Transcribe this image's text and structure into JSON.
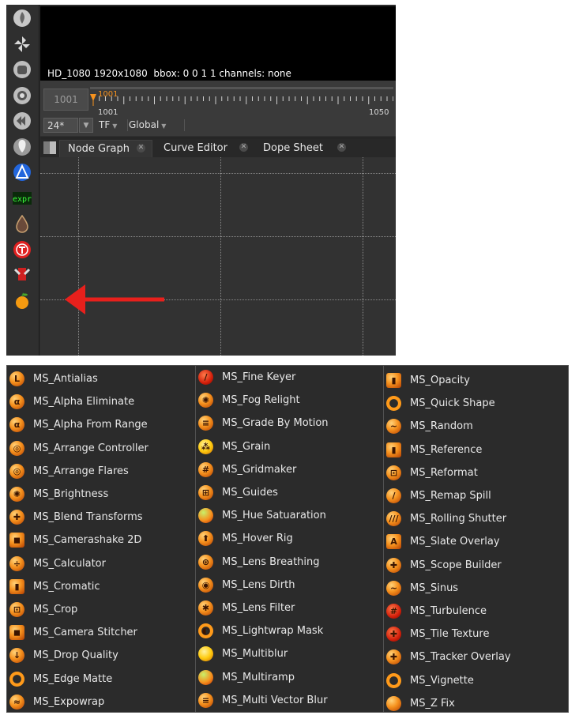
{
  "viewer": {
    "info": "HD_1080 1920x1080  bbox: 0 0 1 1 channels: none"
  },
  "timeline": {
    "current_frame": "1001",
    "marker_label": "1001",
    "start_label": "1001",
    "end_label": "1050"
  },
  "controls": {
    "fps": "24*",
    "tf": "TF",
    "global": "Global"
  },
  "tabs": [
    {
      "label": "Node Graph",
      "active": true
    },
    {
      "label": "Curve Editor",
      "active": false
    },
    {
      "label": "Dope Sheet",
      "active": false
    }
  ],
  "colors": {
    "arrow": "#e8201c",
    "accent": "#f6921e",
    "panel_bg": "#2b2b2b"
  },
  "toolbar_icons": [
    "flame-icon",
    "pinwheel-icon",
    "mask-icon",
    "target-icon",
    "rewind-icon",
    "lightbulb-icon",
    "atom-icon",
    "expr-icon",
    "drop-icon",
    "t-icon",
    "pen-icon",
    "fruit-icon"
  ],
  "menu": {
    "columns": [
      [
        "MS_Antialias",
        "MS_Alpha Eliminate",
        "MS_Alpha From Range",
        "MS_Arrange Controller",
        "MS_Arrange Flares",
        "MS_Brightness",
        "MS_Blend Transforms",
        "MS_Camerashake 2D",
        "MS_Calculator",
        "MS_Cromatic",
        "MS_Crop",
        "MS_Camera Stitcher",
        "MS_Drop Quality",
        "MS_Edge Matte",
        "MS_Expowrap"
      ],
      [
        "MS_Fine Keyer",
        "MS_Fog Relight",
        "MS_Grade By Motion",
        "MS_Grain",
        "MS_Gridmaker",
        "MS_Guides",
        "MS_Hue Satuaration",
        "MS_Hover Rig",
        "MS_Lens Breathing",
        "MS_Lens Dirth",
        "MS_Lens Filter",
        "MS_Lightwrap Mask",
        "MS_Multiblur",
        "MS_Multiramp",
        "MS_Multi Vector Blur"
      ],
      [
        "MS_Opacity",
        "MS_Quick Shape",
        "MS_Random",
        "MS_Reference",
        "MS_Reformat",
        "MS_Remap Spill",
        "MS_Rolling Shutter",
        "MS_Slate Overlay",
        "MS_Scope Builder",
        "MS_Sinus",
        "MS_Turbulence",
        "MS_Tile Texture",
        "MS_Tracker Overlay",
        "MS_Vignette",
        "MS_Z Fix"
      ]
    ]
  }
}
